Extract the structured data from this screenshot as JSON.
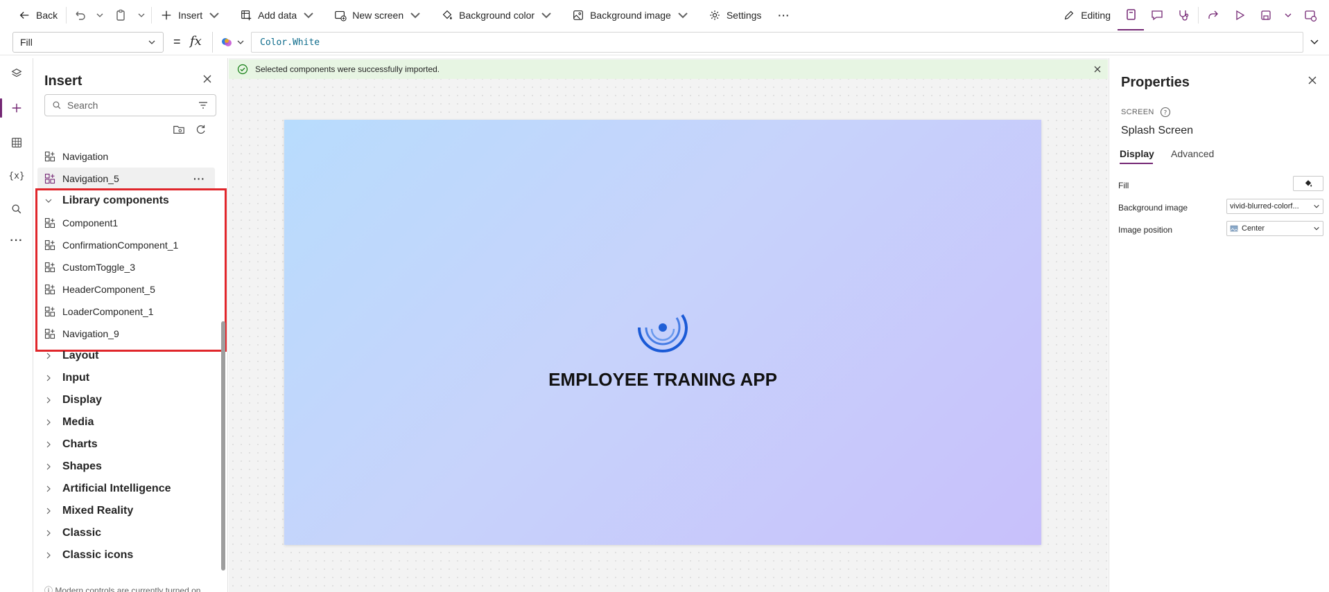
{
  "toolbar": {
    "back": "Back",
    "insert": "Insert",
    "add_data": "Add data",
    "new_screen": "New screen",
    "background_color": "Background color",
    "background_image": "Background image",
    "settings": "Settings",
    "more": "···",
    "editing": "Editing"
  },
  "formula": {
    "property": "Fill",
    "equals": "=",
    "fx": "fx",
    "value": "Color.White"
  },
  "insert_panel": {
    "title": "Insert",
    "search_placeholder": "Search",
    "items": [
      {
        "label": "Navigation"
      },
      {
        "label": "Navigation_5"
      }
    ],
    "more_dots": "···",
    "library": {
      "label": "Library components",
      "items": [
        {
          "label": "Component1"
        },
        {
          "label": "ConfirmationComponent_1"
        },
        {
          "label": "CustomToggle_3"
        },
        {
          "label": "HeaderComponent_5"
        },
        {
          "label": "LoaderComponent_1"
        },
        {
          "label": "Navigation_9"
        }
      ]
    },
    "categories": [
      {
        "label": "Layout"
      },
      {
        "label": "Input"
      },
      {
        "label": "Display"
      },
      {
        "label": "Media"
      },
      {
        "label": "Charts"
      },
      {
        "label": "Shapes"
      },
      {
        "label": "Artificial Intelligence"
      },
      {
        "label": "Mixed Reality"
      },
      {
        "label": "Classic"
      },
      {
        "label": "Classic icons"
      }
    ],
    "footer": "Modern controls are currently turned on"
  },
  "notification": {
    "text": "Selected components were successfully imported."
  },
  "canvas": {
    "app_title": "EMPLOYEE TRANING APP"
  },
  "properties": {
    "title": "Properties",
    "type_label": "SCREEN",
    "screen_name": "Splash Screen",
    "tabs": {
      "display": "Display",
      "advanced": "Advanced"
    },
    "fill_label": "Fill",
    "bg_image_label": "Background image",
    "bg_image_value": "vivid-blurred-colorf...",
    "image_position_label": "Image position",
    "image_position_value": "Center"
  },
  "colors": {
    "accent": "#742774",
    "highlight": "#e0262b",
    "notification_bg": "#e7f5e3"
  }
}
